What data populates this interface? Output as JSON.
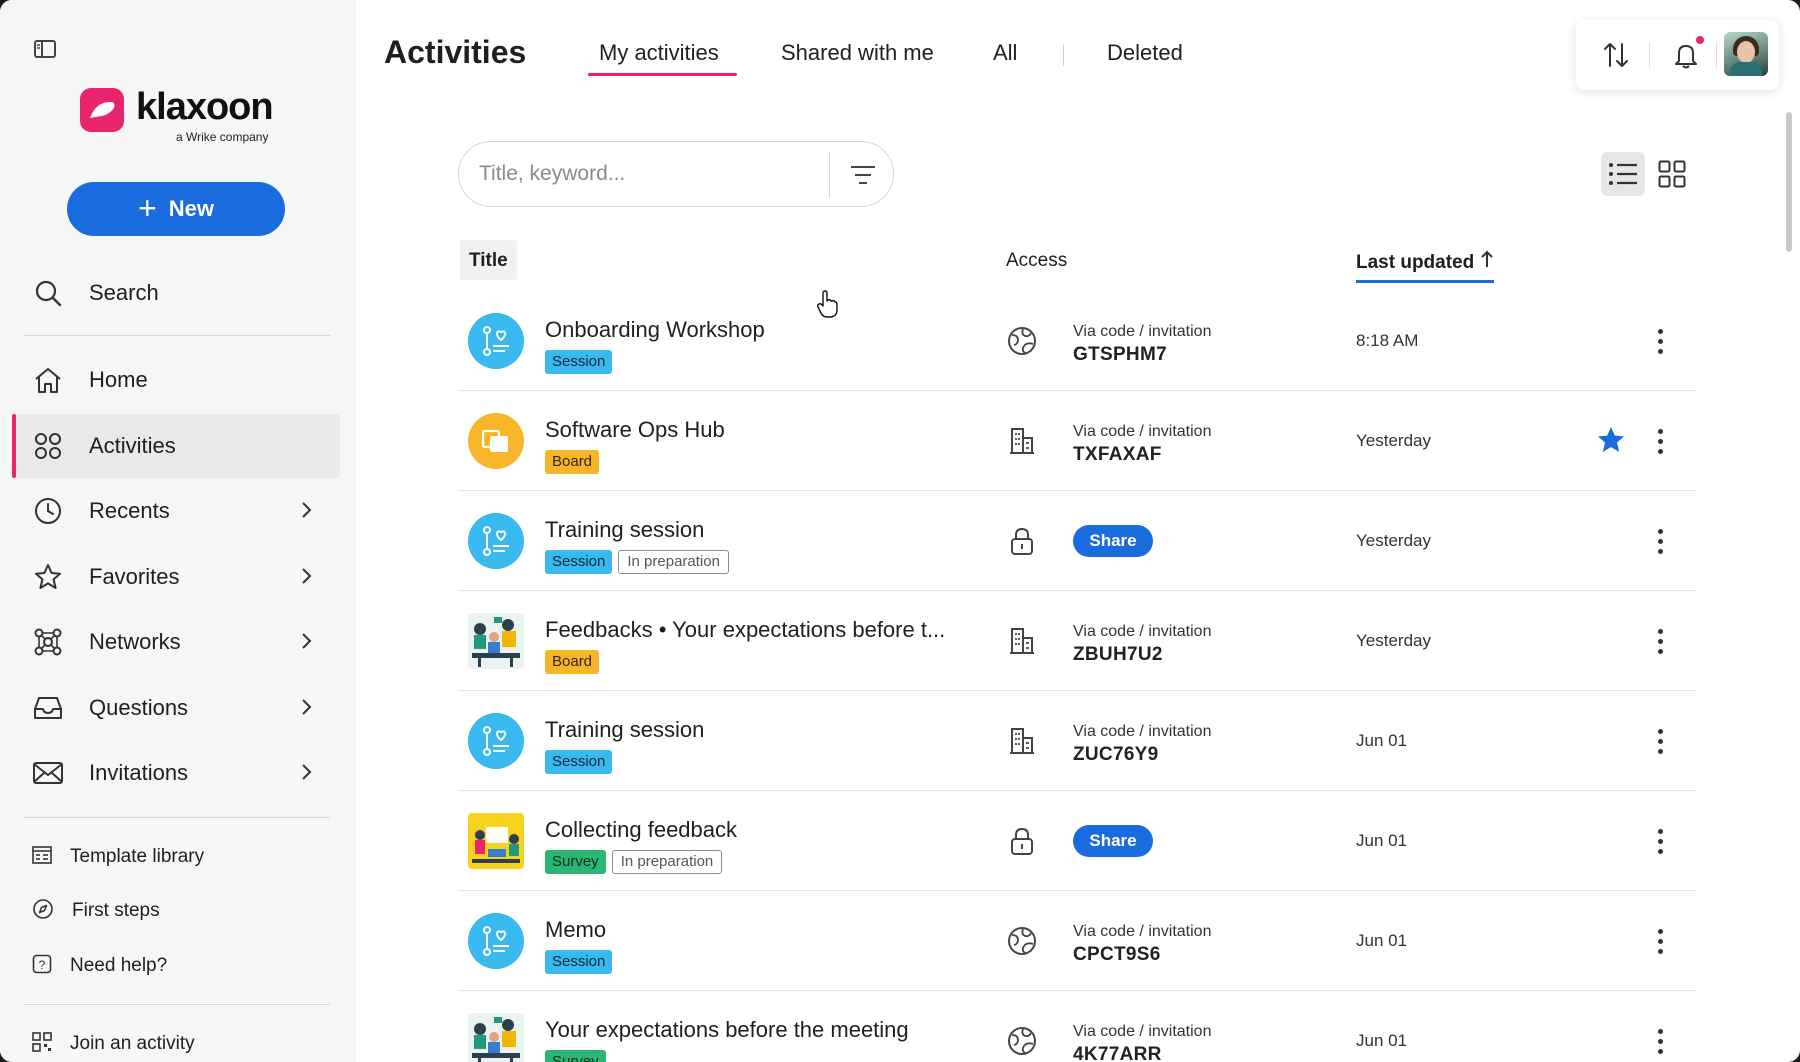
{
  "sidebar": {
    "logo": {
      "word": "klaxoon",
      "sub": "a Wrike company"
    },
    "new_label": "New",
    "search_label": "Search",
    "items": [
      {
        "label": "Home",
        "icon": "home-icon"
      },
      {
        "label": "Activities",
        "icon": "activities-icon",
        "active": true
      },
      {
        "label": "Recents",
        "icon": "clock-icon"
      },
      {
        "label": "Favorites",
        "icon": "star-icon"
      },
      {
        "label": "Networks",
        "icon": "network-icon"
      },
      {
        "label": "Questions",
        "icon": "inbox-icon"
      },
      {
        "label": "Invitations",
        "icon": "mail-icon"
      }
    ],
    "links": [
      {
        "label": "Template library",
        "icon": "template-icon"
      },
      {
        "label": "First steps",
        "icon": "compass-icon"
      },
      {
        "label": "Need help?",
        "icon": "help-icon"
      },
      {
        "label": "Join an activity",
        "icon": "qr-icon"
      }
    ]
  },
  "header": {
    "title": "Activities",
    "tabs": [
      "My activities",
      "Shared with me",
      "All",
      "Deleted"
    ],
    "active_tab": "My activities"
  },
  "search": {
    "placeholder": "Title, keyword..."
  },
  "table": {
    "columns": {
      "title": "Title",
      "access": "Access",
      "updated": "Last updated"
    },
    "rows": [
      {
        "name": "Onboarding Workshop",
        "tags": [
          "Session"
        ],
        "thumb": "session",
        "access_icon": "globe-icon",
        "access_sub": "Via code / invitation",
        "access_code": "GTSPHM7",
        "updated": "8:18 AM",
        "favorite": false
      },
      {
        "name": "Software Ops Hub",
        "tags": [
          "Board"
        ],
        "thumb": "board",
        "access_icon": "building-icon",
        "access_sub": "Via code / invitation",
        "access_code": "TXFAXAF",
        "updated": "Yesterday",
        "favorite": true
      },
      {
        "name": "Training session",
        "tags": [
          "Session",
          "In preparation"
        ],
        "thumb": "session",
        "access_icon": "lock-icon",
        "share_label": "Share",
        "updated": "Yesterday",
        "favorite": false
      },
      {
        "name": "Feedbacks • Your expectations before t...",
        "tags": [
          "Board"
        ],
        "thumb": "image-people",
        "access_icon": "building-icon",
        "access_sub": "Via code / invitation",
        "access_code": "ZBUH7U2",
        "updated": "Yesterday",
        "favorite": false
      },
      {
        "name": "Training session",
        "tags": [
          "Session"
        ],
        "thumb": "session",
        "access_icon": "building-icon",
        "access_sub": "Via code / invitation",
        "access_code": "ZUC76Y9",
        "updated": "Jun 01",
        "favorite": false
      },
      {
        "name": "Collecting feedback",
        "tags": [
          "Survey",
          "In preparation"
        ],
        "thumb": "image-yellow",
        "access_icon": "lock-icon",
        "share_label": "Share",
        "updated": "Jun 01",
        "favorite": false
      },
      {
        "name": "Memo",
        "tags": [
          "Session"
        ],
        "thumb": "session",
        "access_icon": "globe-icon",
        "access_sub": "Via code / invitation",
        "access_code": "CPCT9S6",
        "updated": "Jun 01",
        "favorite": false
      },
      {
        "name": "Your expectations before the meeting",
        "tags": [
          "Survey"
        ],
        "thumb": "image-people",
        "access_icon": "globe-icon",
        "access_sub": "Via code / invitation",
        "access_code": "4K77ARR",
        "updated": "Jun 01",
        "favorite": false
      }
    ]
  },
  "colors": {
    "accent": "#1a6bde",
    "brand": "#e8246f",
    "session": "#3ab9ef",
    "board": "#f7b52a",
    "survey": "#2bb673"
  }
}
